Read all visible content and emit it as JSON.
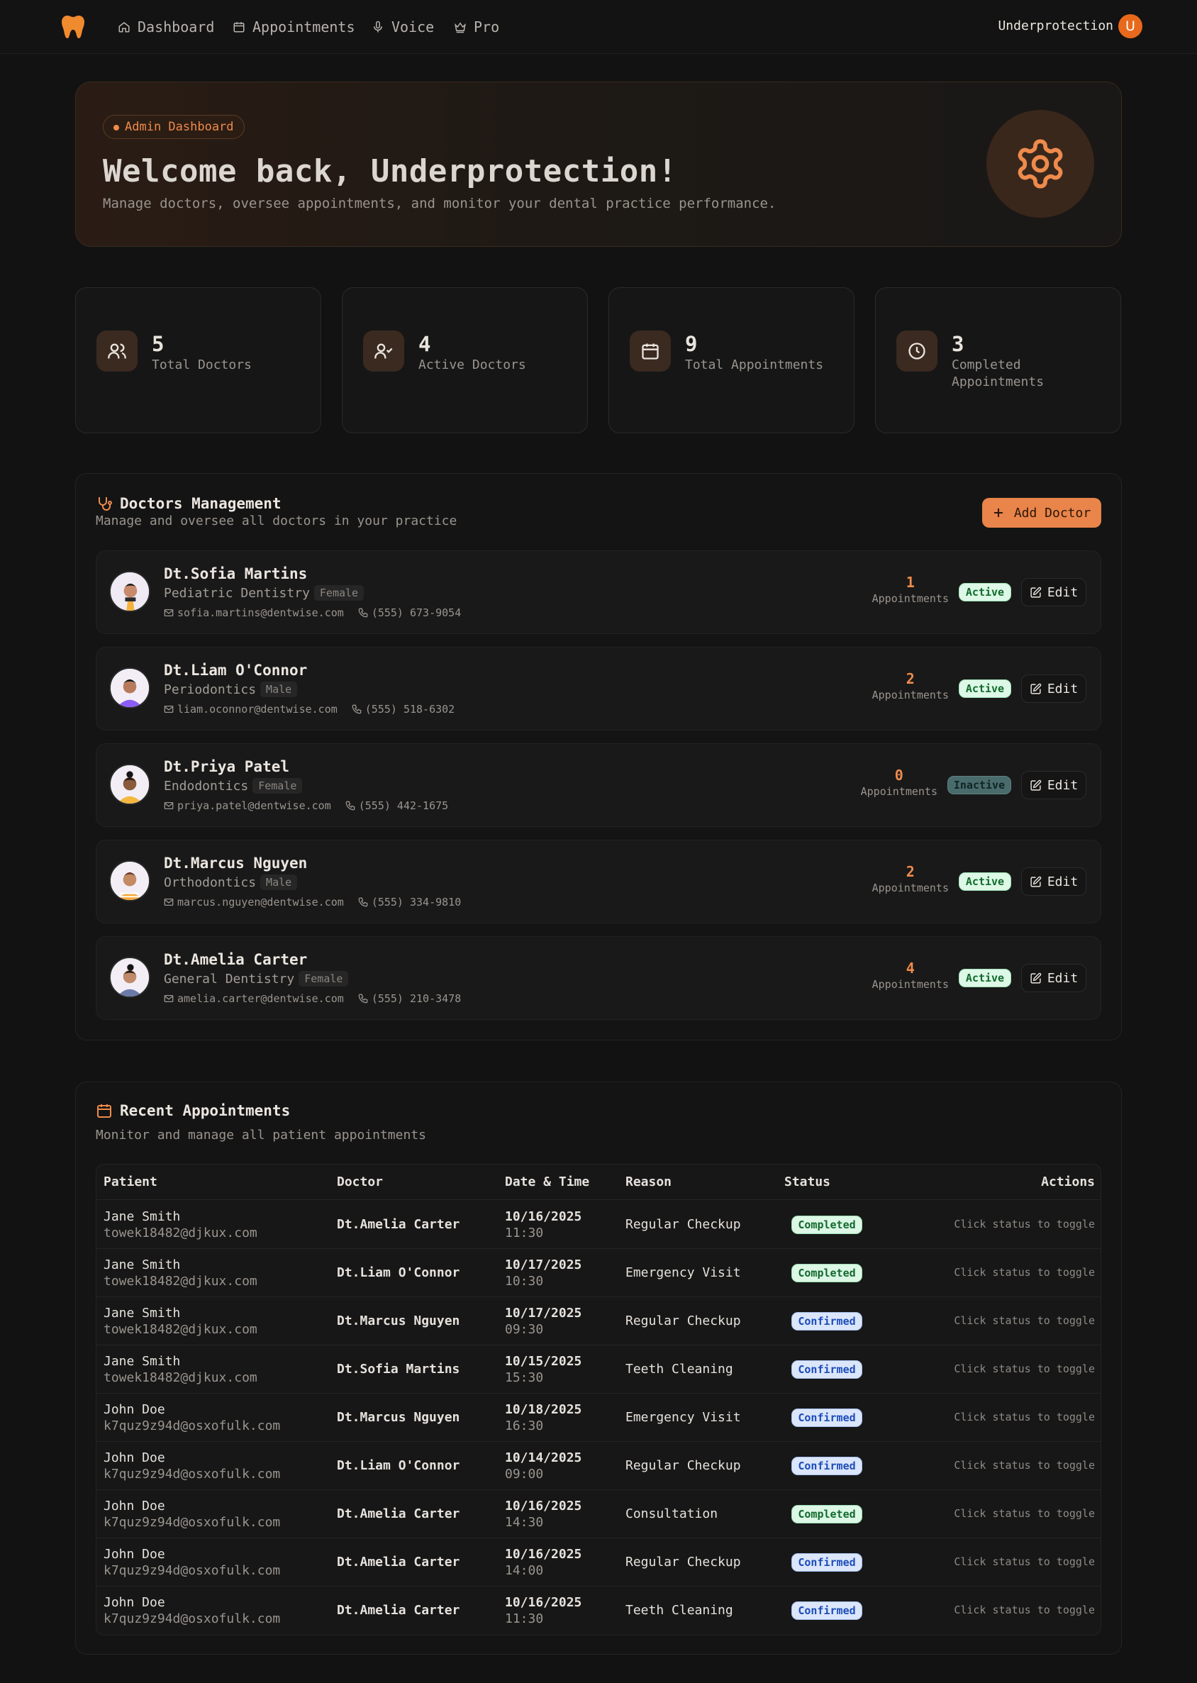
{
  "nav": {
    "items": [
      {
        "label": "Dashboard",
        "icon": "home-icon"
      },
      {
        "label": "Appointments",
        "icon": "calendar-icon"
      },
      {
        "label": "Voice",
        "icon": "microphone-icon"
      },
      {
        "label": "Pro",
        "icon": "crown-icon"
      }
    ],
    "user_name": "Underprotection",
    "avatar_initial": "U"
  },
  "hero": {
    "badge": "Admin Dashboard",
    "title": "Welcome back, Underprotection!",
    "subtitle": "Manage doctors, oversee appointments, and monitor your dental practice performance."
  },
  "stats": [
    {
      "value": "5",
      "label": "Total Doctors",
      "icon": "users-icon"
    },
    {
      "value": "4",
      "label": "Active Doctors",
      "icon": "user-check-icon"
    },
    {
      "value": "9",
      "label": "Total Appointments",
      "icon": "calendar-icon"
    },
    {
      "value": "3",
      "label": "Completed Appointments",
      "icon": "clock-icon"
    }
  ],
  "doctors_panel": {
    "title": "Doctors Management",
    "subtitle": "Manage and oversee all doctors in your practice",
    "add_button": "Add Doctor",
    "appointments_label": "Appointments",
    "edit_label": "Edit",
    "doctors": [
      {
        "name": "Dt.Sofia Martins",
        "specialty": "Pediatric Dentistry",
        "gender": "Female",
        "email": "sofia.martins@dentwise.com",
        "phone": "(555) 673-9054",
        "appointments": "1",
        "status": "Active"
      },
      {
        "name": "Dt.Liam O'Connor",
        "specialty": "Periodontics",
        "gender": "Male",
        "email": "liam.oconnor@dentwise.com",
        "phone": "(555) 518-6302",
        "appointments": "2",
        "status": "Active"
      },
      {
        "name": "Dt.Priya Patel",
        "specialty": "Endodontics",
        "gender": "Female",
        "email": "priya.patel@dentwise.com",
        "phone": "(555) 442-1675",
        "appointments": "0",
        "status": "Inactive"
      },
      {
        "name": "Dt.Marcus Nguyen",
        "specialty": "Orthodontics",
        "gender": "Male",
        "email": "marcus.nguyen@dentwise.com",
        "phone": "(555) 334-9810",
        "appointments": "2",
        "status": "Active"
      },
      {
        "name": "Dt.Amelia Carter",
        "specialty": "General Dentistry",
        "gender": "Female",
        "email": "amelia.carter@dentwise.com",
        "phone": "(555) 210-3478",
        "appointments": "4",
        "status": "Active"
      }
    ]
  },
  "appointments_panel": {
    "title": "Recent Appointments",
    "subtitle": "Monitor and manage all patient appointments",
    "columns": [
      "Patient",
      "Doctor",
      "Date & Time",
      "Reason",
      "Status",
      "Actions"
    ],
    "action_hint": "Click status to toggle",
    "rows": [
      {
        "patient": "Jane Smith",
        "email": "towek18482@djkux.com",
        "doctor": "Dt.Amelia Carter",
        "date": "10/16/2025",
        "time": "11:30",
        "reason": "Regular Checkup",
        "status": "Completed"
      },
      {
        "patient": "Jane Smith",
        "email": "towek18482@djkux.com",
        "doctor": "Dt.Liam O'Connor",
        "date": "10/17/2025",
        "time": "10:30",
        "reason": "Emergency Visit",
        "status": "Completed"
      },
      {
        "patient": "Jane Smith",
        "email": "towek18482@djkux.com",
        "doctor": "Dt.Marcus Nguyen",
        "date": "10/17/2025",
        "time": "09:30",
        "reason": "Regular Checkup",
        "status": "Confirmed"
      },
      {
        "patient": "Jane Smith",
        "email": "towek18482@djkux.com",
        "doctor": "Dt.Sofia Martins",
        "date": "10/15/2025",
        "time": "15:30",
        "reason": "Teeth Cleaning",
        "status": "Confirmed"
      },
      {
        "patient": "John Doe",
        "email": "k7quz9z94d@osxofulk.com",
        "doctor": "Dt.Marcus Nguyen",
        "date": "10/18/2025",
        "time": "16:30",
        "reason": "Emergency Visit",
        "status": "Confirmed"
      },
      {
        "patient": "John Doe",
        "email": "k7quz9z94d@osxofulk.com",
        "doctor": "Dt.Liam O'Connor",
        "date": "10/14/2025",
        "time": "09:00",
        "reason": "Regular Checkup",
        "status": "Confirmed"
      },
      {
        "patient": "John Doe",
        "email": "k7quz9z94d@osxofulk.com",
        "doctor": "Dt.Amelia Carter",
        "date": "10/16/2025",
        "time": "14:30",
        "reason": "Consultation",
        "status": "Completed"
      },
      {
        "patient": "John Doe",
        "email": "k7quz9z94d@osxofulk.com",
        "doctor": "Dt.Amelia Carter",
        "date": "10/16/2025",
        "time": "14:00",
        "reason": "Regular Checkup",
        "status": "Confirmed"
      },
      {
        "patient": "John Doe",
        "email": "k7quz9z94d@osxofulk.com",
        "doctor": "Dt.Amelia Carter",
        "date": "10/16/2025",
        "time": "11:30",
        "reason": "Teeth Cleaning",
        "status": "Confirmed"
      }
    ]
  },
  "colors": {
    "accent": "#ee8b4c",
    "background": "#121212",
    "active_green": "#106a2c",
    "confirmed_blue": "#1d4db8"
  }
}
